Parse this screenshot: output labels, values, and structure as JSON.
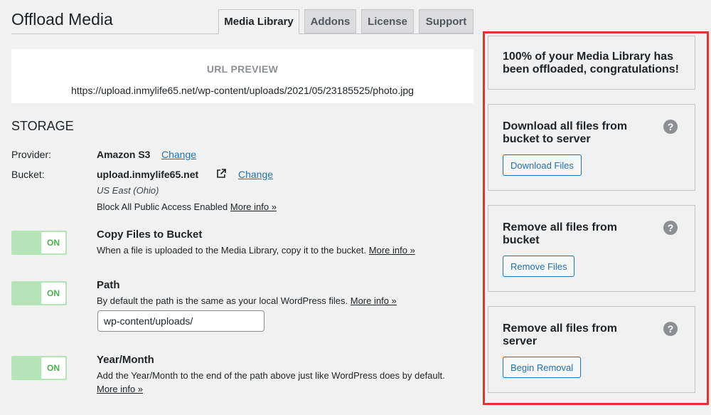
{
  "page": {
    "title": "Offload Media"
  },
  "tabs": [
    {
      "label": "Media Library",
      "active": true
    },
    {
      "label": "Addons",
      "active": false
    },
    {
      "label": "License",
      "active": false
    },
    {
      "label": "Support",
      "active": false
    }
  ],
  "url_preview": {
    "heading": "URL PREVIEW",
    "url": "https://upload.inmylife65.net/wp-content/uploads/2021/05/23185525/photo.jpg"
  },
  "storage": {
    "heading": "STORAGE",
    "provider_label": "Provider:",
    "provider_value": "Amazon S3",
    "provider_change": "Change",
    "bucket_label": "Bucket:",
    "bucket_value": "upload.inmylife65.net",
    "bucket_change": "Change",
    "bucket_region": "US East (Ohio)",
    "block_text": "Block All Public Access Enabled",
    "block_more": "More info »"
  },
  "settings": {
    "copy": {
      "toggle": "ON",
      "title": "Copy Files to Bucket",
      "desc": "When a file is uploaded to the Media Library, copy it to the bucket.",
      "more": "More info »"
    },
    "path": {
      "toggle": "ON",
      "title": "Path",
      "desc": "By default the path is the same as your local WordPress files.",
      "more": "More info »",
      "value": "wp-content/uploads/"
    },
    "yearmonth": {
      "toggle": "ON",
      "title": "Year/Month",
      "desc": "Add the Year/Month to the end of the path above just like WordPress does by default.",
      "more": "More info »"
    }
  },
  "sidebar": {
    "status": {
      "line1": "100% of your Media Library has",
      "line2": "been offloaded, congratulations!"
    },
    "download": {
      "line1": "Download all files from",
      "line2": "bucket to server",
      "button": "Download Files",
      "help": "?"
    },
    "remove_bucket": {
      "line1": "Remove all files from",
      "line2": "bucket",
      "button": "Remove Files",
      "help": "?"
    },
    "remove_server": {
      "line1": "Remove all files from",
      "line2": "server",
      "button": "Begin Removal",
      "help": "?"
    }
  },
  "colors": {
    "accent": "#2271b1",
    "toggle_on": "#b6e4b9",
    "highlight_frame": "#e2332d"
  }
}
